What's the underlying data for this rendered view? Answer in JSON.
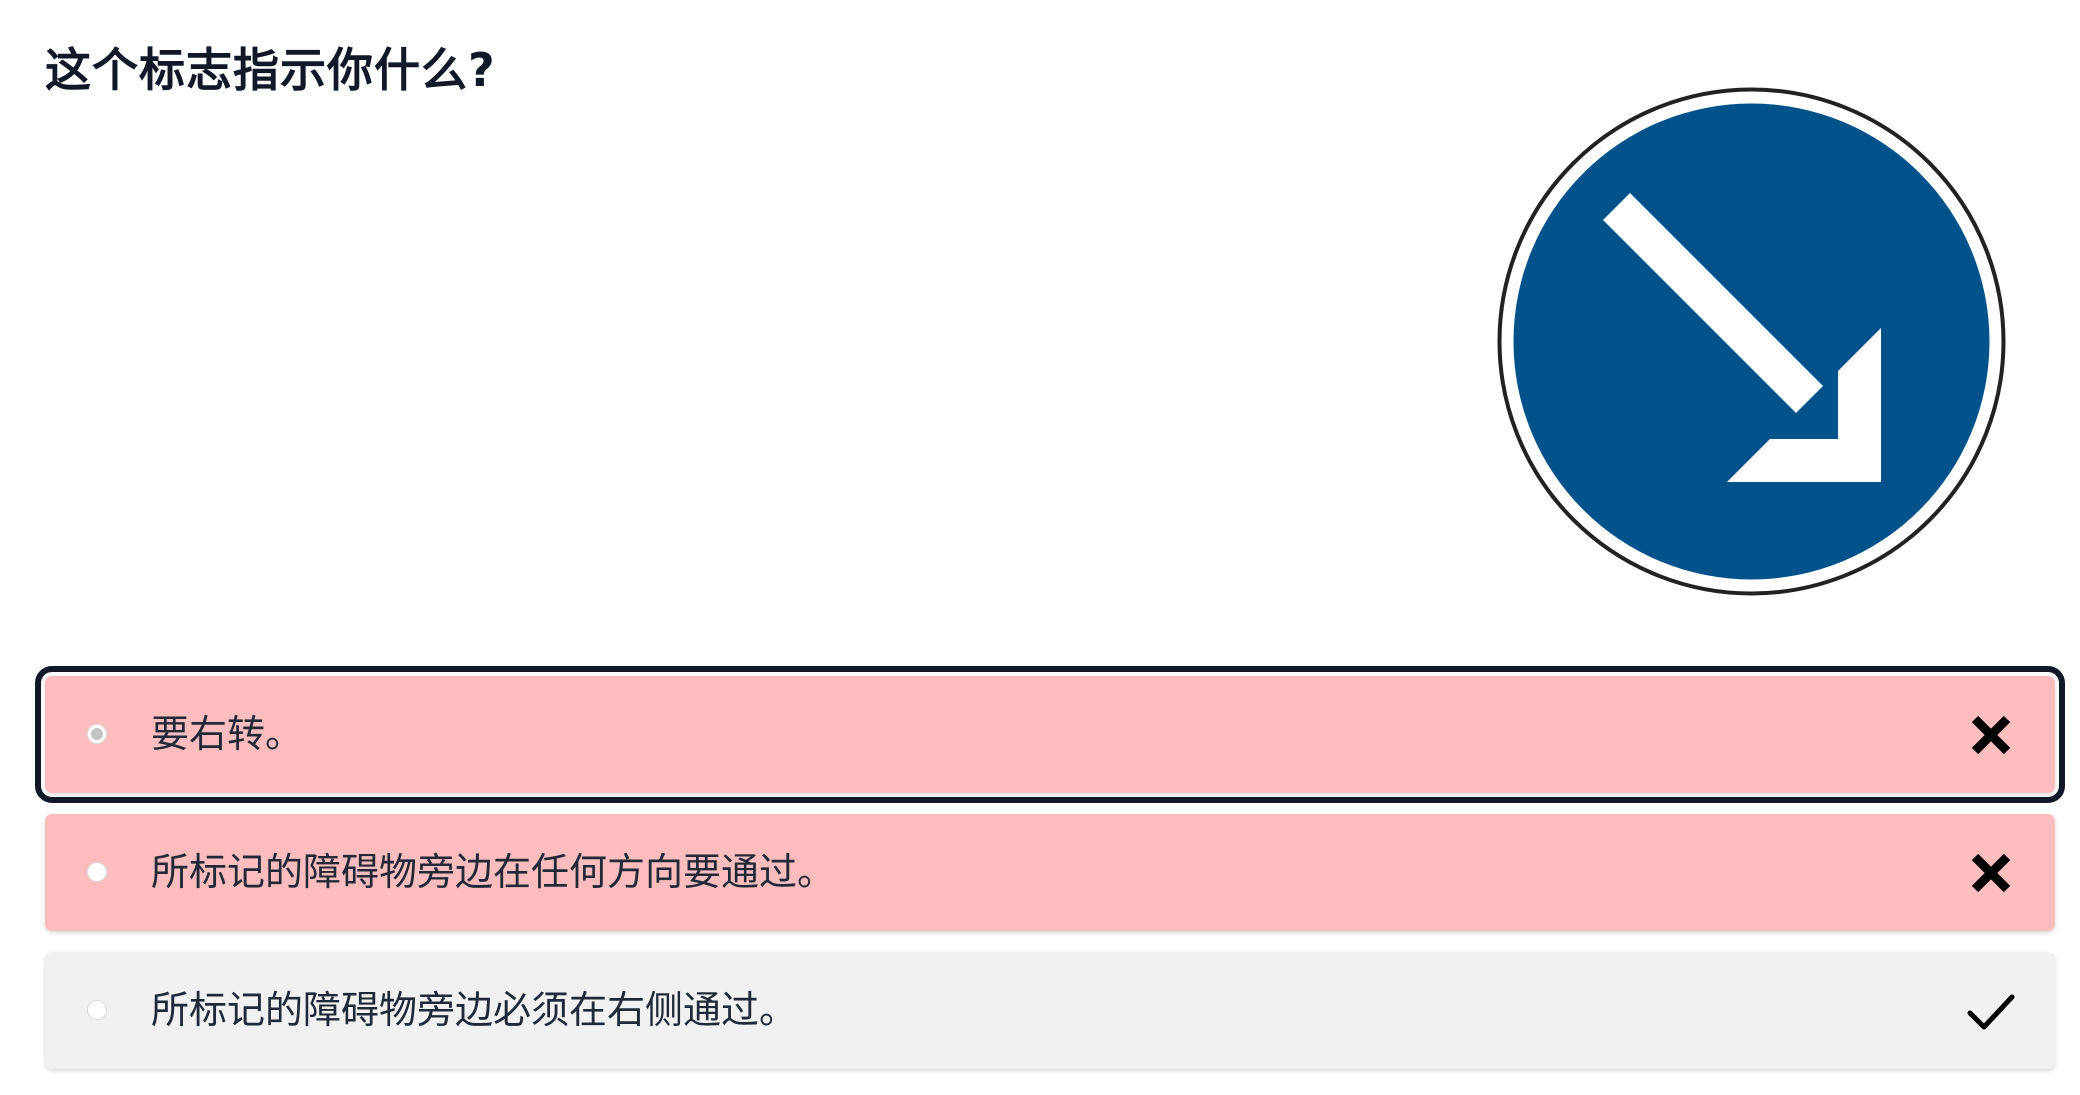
{
  "question": {
    "title": "这个标志指示你什么?"
  },
  "sign": {
    "icon": "keep-right-arrow-icon",
    "background_color": "#00528a",
    "border_color": "#222222",
    "arrow_color": "#ffffff"
  },
  "answers": [
    {
      "label": "要右转。",
      "status": "wrong",
      "selected": true,
      "icon": "cross-icon",
      "background_color": "#fdbdbf"
    },
    {
      "label": "所标记的障碍物旁边在任何方向要通过。",
      "status": "wrong",
      "selected": false,
      "icon": "cross-icon",
      "background_color": "#fdbdbf"
    },
    {
      "label": "所标记的障碍物旁边必须在右侧通过。",
      "status": "correct",
      "selected": false,
      "icon": "checkmark-icon",
      "background_color": "#f1f1f1"
    }
  ]
}
